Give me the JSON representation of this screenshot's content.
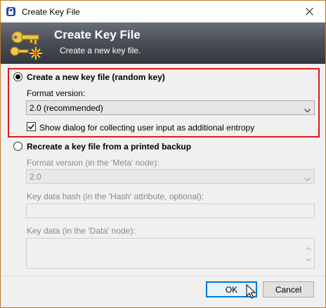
{
  "window": {
    "title": "Create Key File"
  },
  "banner": {
    "title": "Create Key File",
    "subtitle": "Create a new key file."
  },
  "new_key": {
    "radio_label": "Create a new key file (random key)",
    "selected": true,
    "format_label": "Format version:",
    "format_value": "2.0 (recommended)",
    "entropy_checkbox_label": "Show dialog for collecting user input as additional entropy",
    "entropy_checked": true
  },
  "recreate": {
    "radio_label": "Recreate a key file from a printed backup",
    "selected": false,
    "format_label": "Format version (in the 'Meta' node):",
    "format_value": "2.0",
    "hash_label": "Key data hash (in the 'Hash' attribute, optional):",
    "hash_value": "",
    "data_label": "Key data (in the 'Data' node):",
    "data_value": ""
  },
  "buttons": {
    "ok": "OK",
    "cancel": "Cancel"
  },
  "colors": {
    "highlight_border": "#e01818",
    "banner_dark": "#34373d",
    "default_button": "#0078d7"
  },
  "icons": {
    "title": "keepass-lock-icon",
    "banner": "key-new-icon",
    "close": "close-icon",
    "dropdown": "chevron-down-icon",
    "scroll_up": "scroll-up-arrow-icon",
    "scroll_down": "scroll-down-arrow-icon"
  }
}
